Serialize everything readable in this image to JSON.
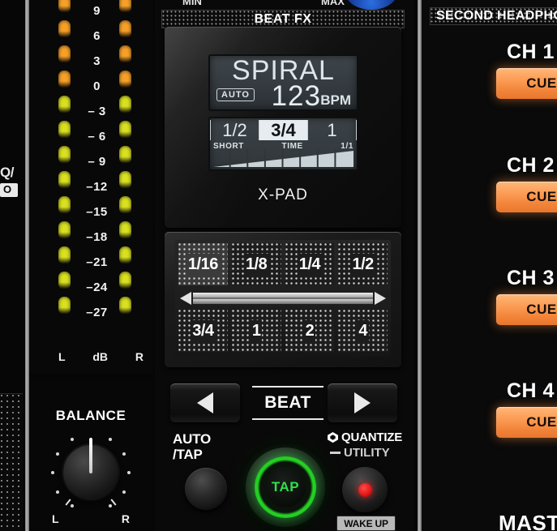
{
  "left_edge": {
    "partial_label": "Q/",
    "chip_label": "O"
  },
  "meter": {
    "scale_labels": [
      "9",
      "6",
      "3",
      "0",
      "– 3",
      "– 6",
      "– 9",
      "–12",
      "–15",
      "–18",
      "–21",
      "–24",
      "–27"
    ],
    "segment_colors": [
      "#f6a028",
      "#f6a028",
      "#f6a028",
      "#f6a028",
      "#d8e021",
      "#d8e021",
      "#d8e021",
      "#d8e021",
      "#d8e021",
      "#d8e021",
      "#d8e021",
      "#d8e021",
      "#d8e021"
    ],
    "foot_left": "L",
    "foot_center": "dB",
    "foot_right": "R"
  },
  "balance": {
    "title": "BALANCE",
    "left_label": "L",
    "right_label": "R"
  },
  "fx": {
    "top_min": "MIN",
    "top_max": "MAX",
    "header": "BEAT FX",
    "xpad_label": "X-PAD",
    "display": {
      "fx_name": "SPIRAL",
      "auto_badge": "AUTO",
      "bpm_value": "123",
      "bpm_unit": "BPM",
      "time_cells": [
        {
          "label": "1/2",
          "selected": false
        },
        {
          "label": "3/4",
          "selected": true
        },
        {
          "label": "1",
          "selected": false
        }
      ],
      "label_short": "SHORT",
      "label_time": "TIME",
      "label_max": "1/1"
    },
    "pads_top": [
      {
        "label": "1/16",
        "active": true
      },
      {
        "label": "1/8",
        "active": false
      },
      {
        "label": "1/4",
        "active": false
      },
      {
        "label": "1/2",
        "active": false
      }
    ],
    "pads_bottom": [
      {
        "label": "3/4",
        "active": false
      },
      {
        "label": "1",
        "active": false
      },
      {
        "label": "2",
        "active": false
      },
      {
        "label": "4",
        "active": false
      }
    ],
    "beat_label": "BEAT",
    "beat_prev_icon": "triangle-left-icon",
    "beat_next_icon": "triangle-right-icon",
    "auto_tap_label": "AUTO\n/TAP",
    "auto_tap_line1": "AUTO",
    "auto_tap_line2": "/TAP",
    "tap_label": "TAP",
    "tap_active": true,
    "tap_color": "#2fe04a",
    "quantize_label": "QUANTIZE",
    "quantize_icon": "quantize-hex-icon",
    "utility_label": "UTILITY",
    "wake_up_label": "WAKE UP",
    "indicator_color": "#e01414"
  },
  "right_panel": {
    "header": "SECOND HEADPHONES",
    "cue_color": "#fb9a52",
    "channels": [
      {
        "title": "CH 1",
        "cue_label": "CUE"
      },
      {
        "title": "CH 2",
        "cue_label": "CUE"
      },
      {
        "title": "CH 3",
        "cue_label": "CUE"
      },
      {
        "title": "CH 4",
        "cue_label": "CUE"
      }
    ],
    "master_title": "MASTER"
  }
}
